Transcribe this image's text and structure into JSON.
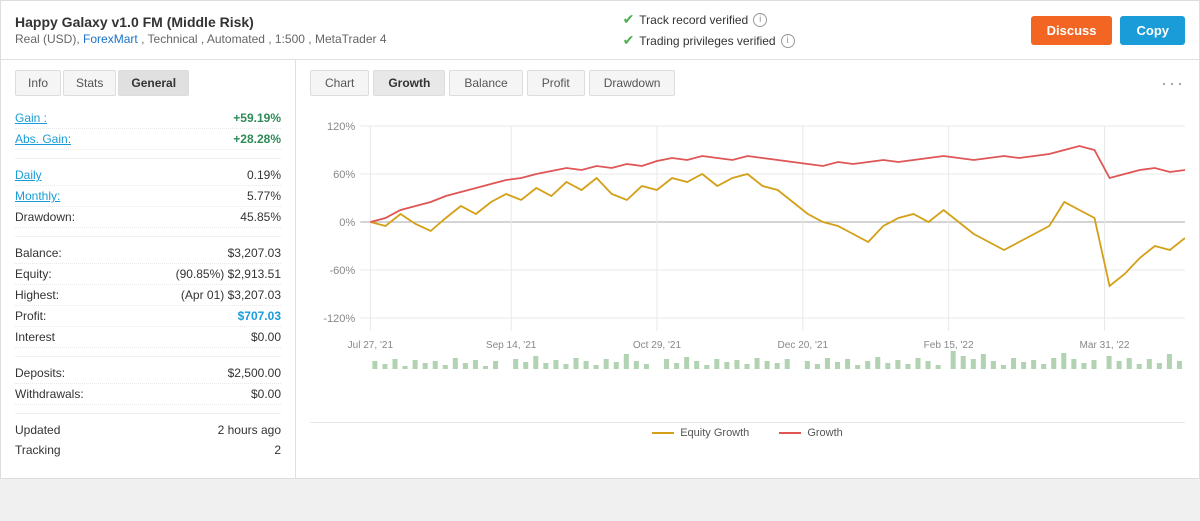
{
  "header": {
    "title": "Happy Galaxy v1.0 FM (Middle Risk)",
    "subtitle_text": "Real (USD),",
    "subtitle_link": "ForexMart",
    "subtitle_rest": ", Technical , Automated , 1:500 , MetaTrader 4",
    "verified1": "Track record verified",
    "verified2": "Trading privileges verified",
    "btn_discuss": "Discuss",
    "btn_copy": "Copy"
  },
  "section_tabs": [
    {
      "label": "Info",
      "active": false
    },
    {
      "label": "Stats",
      "active": false
    },
    {
      "label": "General",
      "active": true
    }
  ],
  "stats": {
    "gain_label": "Gain :",
    "gain_value": "+59.19%",
    "abs_gain_label": "Abs. Gain:",
    "abs_gain_value": "+28.28%",
    "daily_label": "Daily",
    "daily_value": "0.19%",
    "monthly_label": "Monthly:",
    "monthly_value": "5.77%",
    "drawdown_label": "Drawdown:",
    "drawdown_value": "45.85%",
    "balance_label": "Balance:",
    "balance_value": "$3,207.03",
    "equity_label": "Equity:",
    "equity_value": "(90.85%) $2,913.51",
    "highest_label": "Highest:",
    "highest_value": "(Apr 01) $3,207.03",
    "profit_label": "Profit:",
    "profit_value": "$707.03",
    "interest_label": "Interest",
    "interest_value": "$0.00",
    "deposits_label": "Deposits:",
    "deposits_value": "$2,500.00",
    "withdrawals_label": "Withdrawals:",
    "withdrawals_value": "$0.00",
    "updated_label": "Updated",
    "updated_value": "2 hours ago",
    "tracking_label": "Tracking",
    "tracking_value": "2"
  },
  "chart_tabs": [
    {
      "label": "Chart",
      "active": false
    },
    {
      "label": "Growth",
      "active": true
    },
    {
      "label": "Balance",
      "active": false
    },
    {
      "label": "Profit",
      "active": false
    },
    {
      "label": "Drawdown",
      "active": false
    }
  ],
  "chart": {
    "x_labels": [
      "Jul 27, '21",
      "Sep 14, '21",
      "Oct 29, '21",
      "Dec 20, '21",
      "Feb 15, '22",
      "Mar 31, '22"
    ],
    "y_labels": [
      "120%",
      "60%",
      "0%",
      "-60%",
      "-120%"
    ],
    "legend": {
      "equity_label": "Equity Growth",
      "growth_label": "Growth"
    }
  }
}
